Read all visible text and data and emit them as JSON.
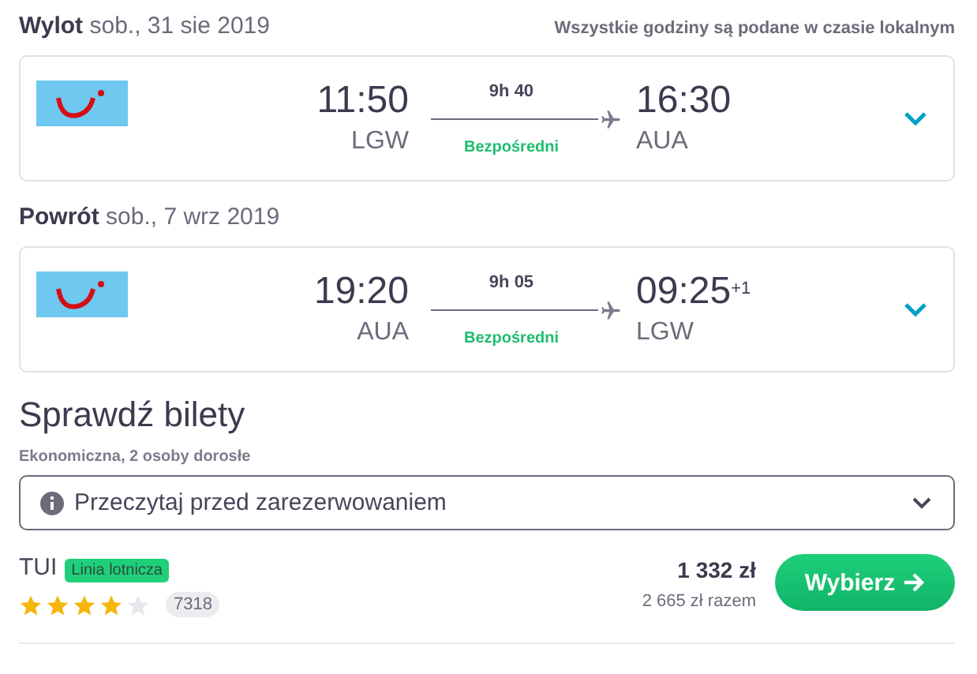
{
  "legs": [
    {
      "label": "Wylot",
      "date": "sob., 31 sie 2019",
      "note": "Wszystkie godziny są podane w czasie lokalnym",
      "departure_time": "11:50",
      "departure_airport": "LGW",
      "duration": "9h 40",
      "stops": "Bezpośredni",
      "arrival_time": "16:30",
      "arrival_airport": "AUA",
      "expanded": false
    },
    {
      "label": "Powrót",
      "date": "sob., 7 wrz 2019",
      "departure_time": "19:20",
      "departure_airport": "AUA",
      "duration": "9h 05",
      "stops": "Bezpośredni",
      "arrival_time": "09:25",
      "day_offset": "+1",
      "arrival_airport": "LGW",
      "expanded": false
    }
  ],
  "tickets": {
    "title": "Sprawdź bilety",
    "subtitle": "Ekonomiczna, 2 osoby dorosłe",
    "info": {
      "label": "Przeczytaj przed zarezerwowaniem",
      "expanded": false
    },
    "offer": {
      "provider": "TUI",
      "tag": "Linia lotnicza",
      "stars": 4,
      "reviews": "7318",
      "price": "1 332 zł",
      "total": "2 665 zł razem",
      "button": "Wybierz"
    }
  }
}
